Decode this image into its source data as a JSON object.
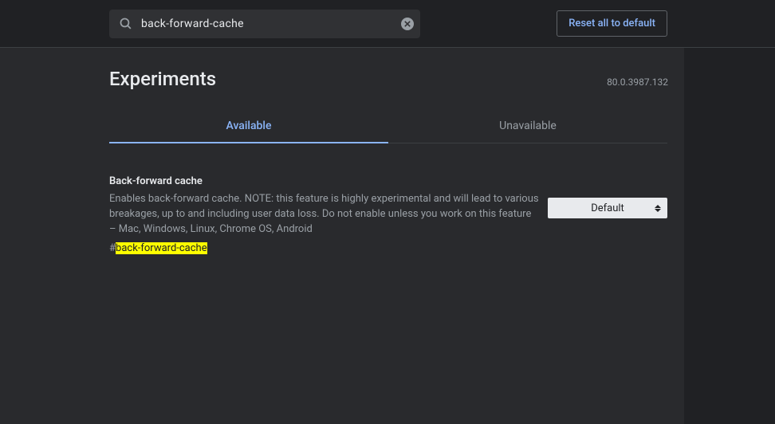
{
  "header": {
    "search_value": "back-forward-cache",
    "reset_label": "Reset all to default"
  },
  "page": {
    "title": "Experiments",
    "version": "80.0.3987.132"
  },
  "tabs": {
    "available": "Available",
    "unavailable": "Unavailable"
  },
  "flag": {
    "title": "Back-forward cache",
    "description": "Enables back-forward cache. NOTE: this feature is highly experimental and will lead to various breakages, up to and including user data loss. Do not enable unless you work on this feature – Mac, Windows, Linux, Chrome OS, Android",
    "anchor_hash": "#",
    "anchor_name": "back-forward-cache",
    "select_value": "Default"
  }
}
